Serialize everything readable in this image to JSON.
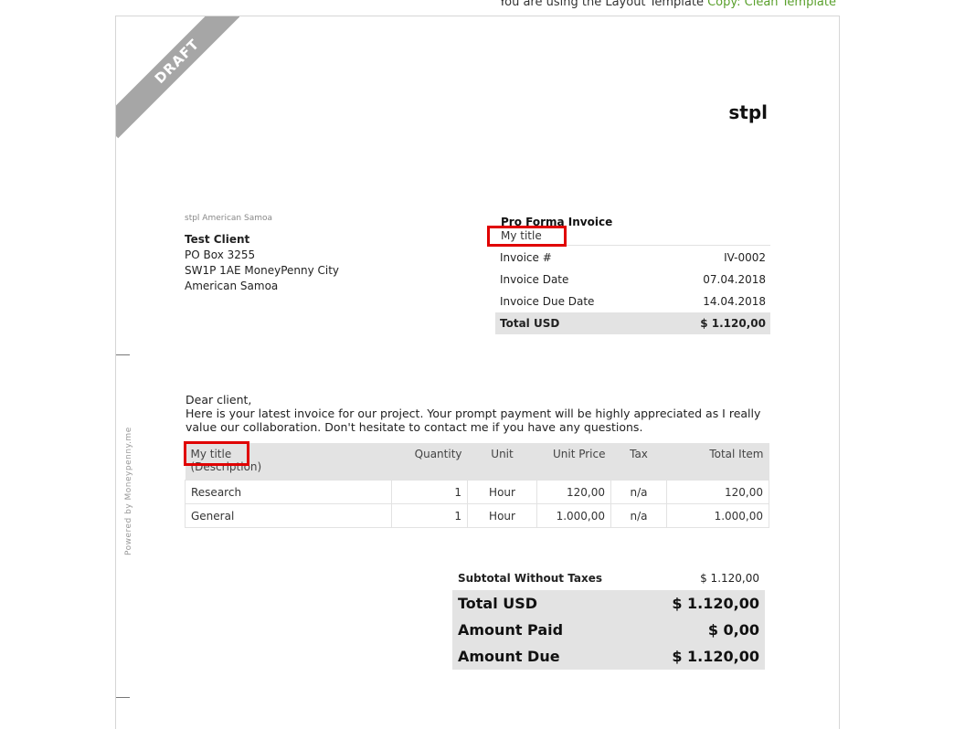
{
  "top_note": {
    "prefix": "You are using the Layout Template ",
    "template_name": "Copy: Clean Template"
  },
  "ribbon": "DRAFT",
  "powered_by": "Powered by Moneypenny.me",
  "company_name": "stpl",
  "sender_line": "stpl American Samoa",
  "client": {
    "name": "Test Client",
    "address": [
      "PO Box 3255",
      "SW1P 1AE MoneyPenny City",
      "American Samoa"
    ]
  },
  "invoice": {
    "doc_type": "Pro Forma Invoice",
    "title": "My title",
    "rows": [
      {
        "label": "Invoice #",
        "value": "IV-0002"
      },
      {
        "label": "Invoice Date",
        "value": "07.04.2018"
      },
      {
        "label": "Invoice Due Date",
        "value": "14.04.2018"
      }
    ],
    "total": {
      "label": "Total USD",
      "value": "$ 1.120,00"
    }
  },
  "letter": {
    "greeting": "Dear client,",
    "body": "Here is your latest invoice for our project. Your prompt payment will be highly appreciated as I really value our collaboration. Don't hesitate to contact me if you have any questions."
  },
  "items": {
    "headers": {
      "item": "My title",
      "item_sub": "(Description)",
      "quantity": "Quantity",
      "unit": "Unit",
      "unit_price": "Unit Price",
      "tax": "Tax",
      "total": "Total Item"
    },
    "rows": [
      {
        "item": "Research",
        "quantity": "1",
        "unit": "Hour",
        "unit_price": "120,00",
        "tax": "n/a",
        "total": "120,00"
      },
      {
        "item": "General",
        "quantity": "1",
        "unit": "Hour",
        "unit_price": "1.000,00",
        "tax": "n/a",
        "total": "1.000,00"
      }
    ]
  },
  "totals": {
    "subtotal": {
      "label": "Subtotal Without Taxes",
      "value": "$ 1.120,00"
    },
    "total": {
      "label": "Total USD",
      "value": "$ 1.120,00"
    },
    "paid": {
      "label": "Amount Paid",
      "value": "$ 0,00"
    },
    "due": {
      "label": "Amount Due",
      "value": "$ 1.120,00"
    }
  },
  "highlight_color": "#e00000",
  "accent_color": "#5aa02c"
}
